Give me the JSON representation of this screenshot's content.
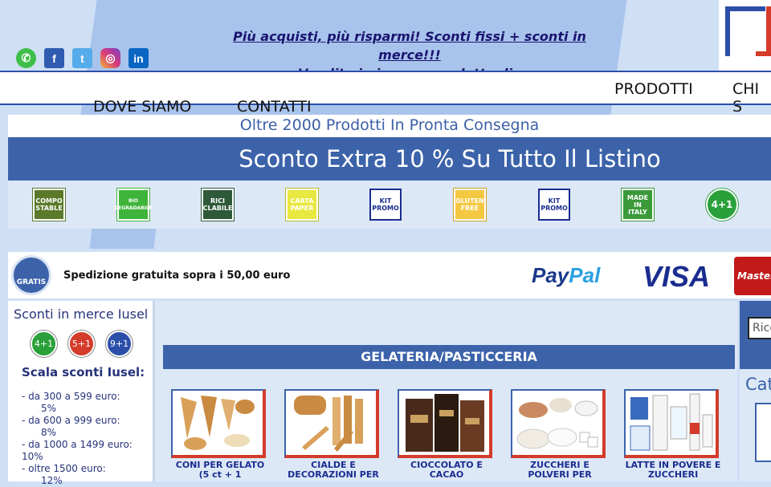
{
  "header": {
    "social": [
      {
        "icon": "whatsapp-icon",
        "glyph": "✆"
      },
      {
        "icon": "facebook-icon",
        "glyph": "f"
      },
      {
        "icon": "twitter-icon",
        "glyph": "t"
      },
      {
        "icon": "instagram-icon",
        "glyph": "◎"
      },
      {
        "icon": "linkedin-icon",
        "glyph": "in"
      }
    ],
    "promo_line1": "Più acquisti, più risparmi! Sconti fissi + sconti in merce!!!",
    "promo_line2": "Vendita in ingrosso e dettaglio"
  },
  "nav": {
    "prodotti": "PRODOTTI",
    "chi_siamo": "CHI S",
    "dove_siamo": "DOVE SIAMO",
    "contatti": "CONTATTI"
  },
  "tagline": "Oltre 2000 Prodotti In Pronta Consegna",
  "banner": "Sconto Extra 10 % Su Tutto Il Listino",
  "badges": [
    {
      "label": "COMPO STABLE",
      "bg": "#5a7a2a",
      "fg": "#ffffff"
    },
    {
      "label": "BIO DEGRADABILE",
      "bg": "#3fb43a",
      "fg": "#ffffff"
    },
    {
      "label": "RICI CLABILE",
      "bg": "#2f5a3a",
      "fg": "#ffffff"
    },
    {
      "label": "CARTA PAPER",
      "bg": "#e8e840",
      "fg": "#ffffff"
    },
    {
      "label": "KIT PROMO",
      "bg": "#ffffff",
      "fg": "#1a2d8f"
    },
    {
      "label": "GLUTEN FREE",
      "bg": "#f5c842",
      "fg": "#ffffff"
    },
    {
      "label": "KIT PROMO",
      "bg": "#ffffff",
      "fg": "#1a2d8f"
    },
    {
      "label": "MADE IN ITALY",
      "bg": "#3a9a3a",
      "fg": "#ffffff"
    },
    {
      "label": "4+1",
      "bg": "#2aa03a",
      "fg": "#ffffff"
    }
  ],
  "shipping": {
    "truck_label": "GRATIS",
    "text": "Spedizione gratuita sopra i 50,00 euro",
    "paypal_a": "Pay",
    "paypal_b": "Pal",
    "visa": "VISA",
    "mastercard": "Master"
  },
  "sidebar": {
    "title": "Sconti in merce Iusel",
    "offers": [
      {
        "label": "4+1",
        "color": "#2aa03a"
      },
      {
        "label": "5+1",
        "color": "#d43b2a"
      },
      {
        "label": "9+1",
        "color": "#2b4fa8"
      }
    ],
    "scala_title": "Scala sconti Iusel:",
    "scala": [
      "- da 300 a 599 euro:",
      "     5%",
      "- da 600 a 999 euro:",
      "     8%",
      "- da 1000 a 1499 euro:",
      "10%",
      "- oltre 1500 euro:",
      "     12%"
    ]
  },
  "main": {
    "category": "GELATERIA/PASTICCERIA",
    "cards": [
      {
        "label": "CONI PER GELATO (5 ct + 1",
        "icon": "cone-icon"
      },
      {
        "label": "CIALDE E DECORAZIONI PER",
        "icon": "wafer-icon"
      },
      {
        "label": "CIOCCOLATO E CACAO",
        "icon": "chocolate-icon"
      },
      {
        "label": "ZUCCHERI E POLVERI PER",
        "icon": "sugar-icon"
      },
      {
        "label": "LATTE IN POVERE E ZUCCHERI",
        "icon": "milk-icon"
      }
    ]
  },
  "right": {
    "search_placeholder": "Rice",
    "categories_title": "Cat"
  }
}
